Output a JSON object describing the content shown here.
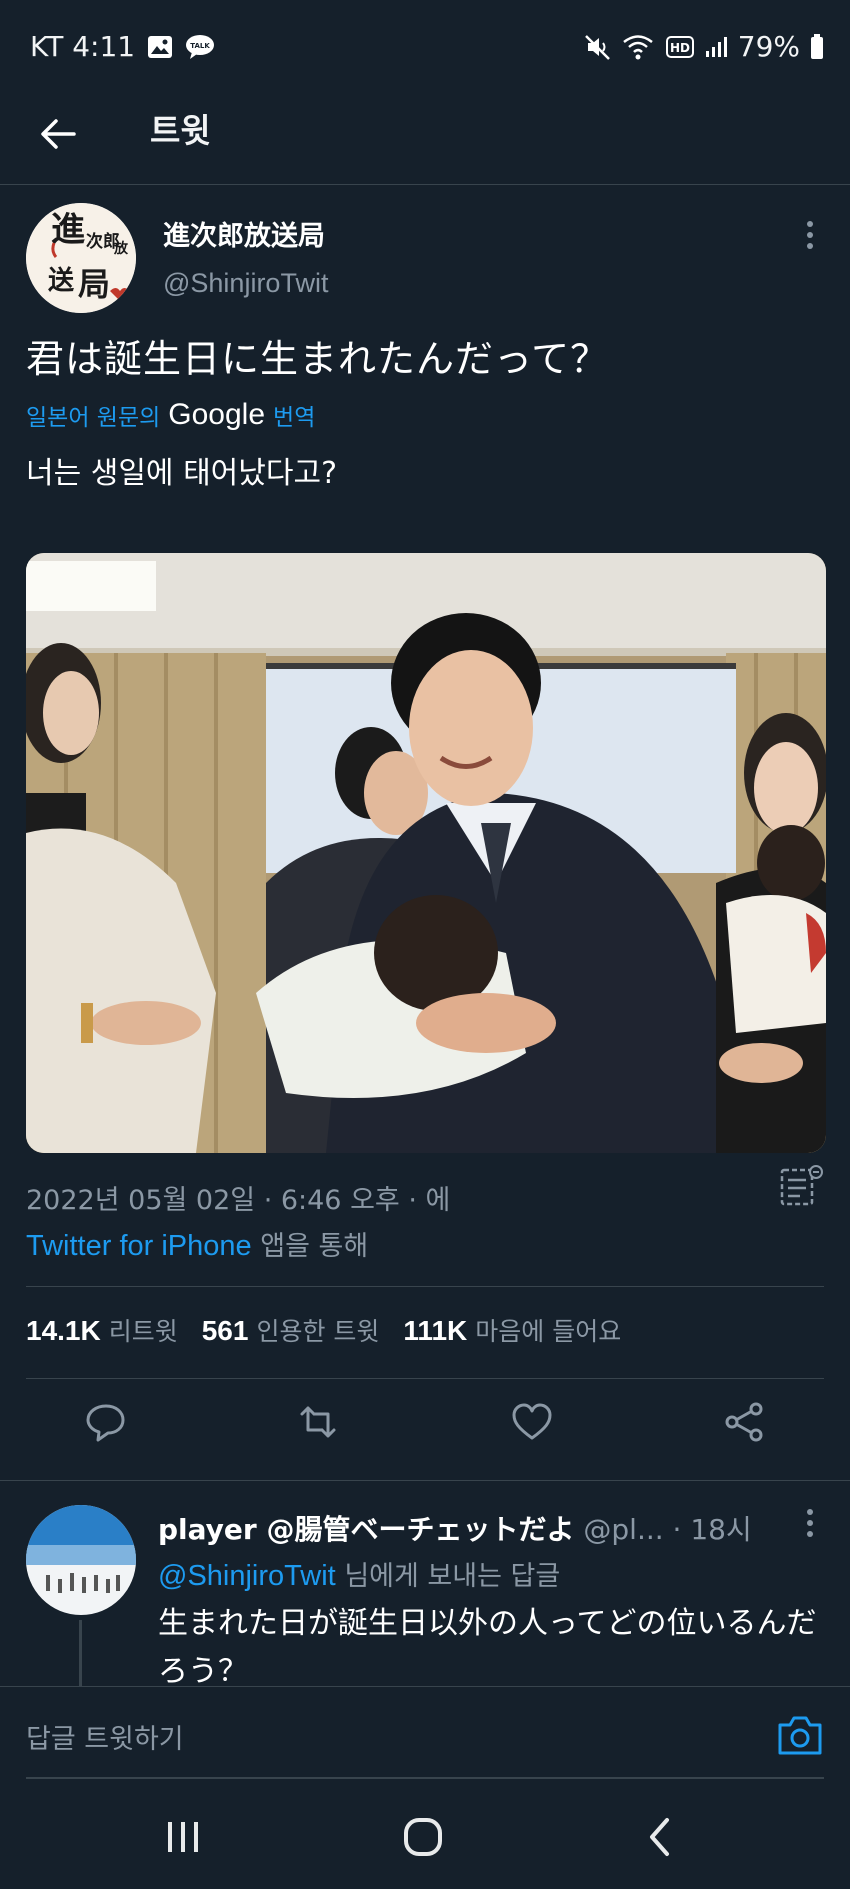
{
  "status_bar": {
    "carrier_time": "KT 4:11",
    "battery": "79%"
  },
  "header": {
    "title": "트윗"
  },
  "tweet": {
    "author_name": "進次郎放送局",
    "author_handle": "@ShinjiroTwit",
    "avatar_text": [
      "進",
      "次郎",
      "放",
      "送",
      "局"
    ],
    "text": "君は誕生日に生まれたんだって？",
    "translate_prefix": "일본어 원문의",
    "translate_google": "Google",
    "translate_suffix": "번역",
    "translated_text": "너는 생일에 태어났다고?",
    "timestamp": "2022년 05월 02일 · 6:46 오후 · 에",
    "source_link": "Twitter for iPhone",
    "source_suffix": "앱을 통해",
    "stats": {
      "retweets_count": "14.1K",
      "retweets_label": "리트윗",
      "quotes_count": "561",
      "quotes_label": "인용한 트윗",
      "likes_count": "111K",
      "likes_label": "마음에 들어요"
    }
  },
  "reply": {
    "name": "player @腸管ベーチェットだよ",
    "handle_time": "@pl... · 18시",
    "to_handle": "@ShinjiroTwit",
    "to_suffix": "님에게 보내는 답글",
    "text": "生まれた日が誕生日以外の人ってどの位いるんだろう？"
  },
  "reply_bar": {
    "placeholder": "답글 트윗하기"
  },
  "colors": {
    "background": "#15202b",
    "accent": "#1d9bf0",
    "muted": "#8b98a5"
  }
}
